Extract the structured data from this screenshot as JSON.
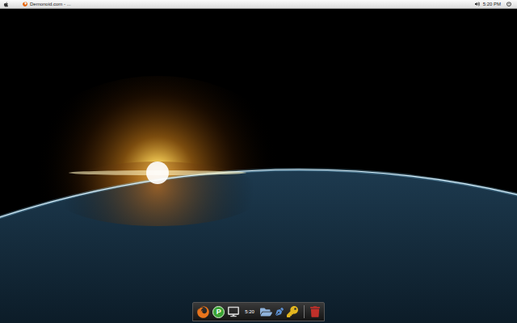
{
  "top_bar": {
    "window_title": "Demonoid.com - ...",
    "clock": "5:20 PM"
  },
  "dock": {
    "clock": "5:20",
    "app_letter": "P"
  }
}
